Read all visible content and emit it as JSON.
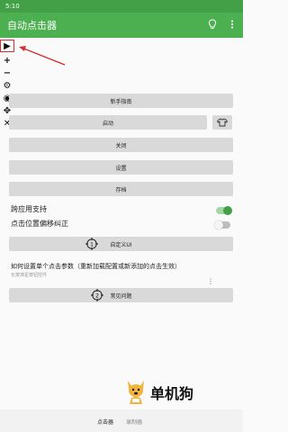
{
  "status": {
    "time": "5:10"
  },
  "appbar": {
    "title": "自动点击器",
    "icons": [
      "bulb-icon",
      "more-vert-icon"
    ]
  },
  "floating_toolbar": {
    "icons": [
      "play-icon",
      "plus-icon",
      "minus-icon",
      "gear-icon",
      "eye-off-icon",
      "move-icon",
      "close-icon"
    ],
    "glyphs": {
      "play": "▶",
      "plus": "+",
      "minus": "−",
      "gear": "⚙",
      "eye": "◉",
      "move": "✥",
      "close": "✕"
    }
  },
  "buttons": {
    "guide": "新手指南",
    "start": "启动",
    "close": "关闭",
    "settings": "设置",
    "save": "存档"
  },
  "toggles": {
    "cross_app": {
      "label": "跨应用支持",
      "on": true
    },
    "offset_fix": {
      "label": "点击位置偏移纠正",
      "on": false
    }
  },
  "target1": {
    "number": "1",
    "label": "自定义UI"
  },
  "info": {
    "title": "如何设置单个点击参数（重新加载配置或新添加的点击生效）",
    "subtitle": "长按准星按钮控件",
    "more": "⋮"
  },
  "target2": {
    "number": "2",
    "label": "常见问题"
  },
  "brand": {
    "text": "单机狗"
  },
  "bottom_nav": {
    "tabs": [
      "点击器",
      "录制器"
    ],
    "active": 0
  },
  "colors": {
    "primary": "#4caf50",
    "statusbar": "#43a047",
    "accent_red": "#d32f2f"
  }
}
